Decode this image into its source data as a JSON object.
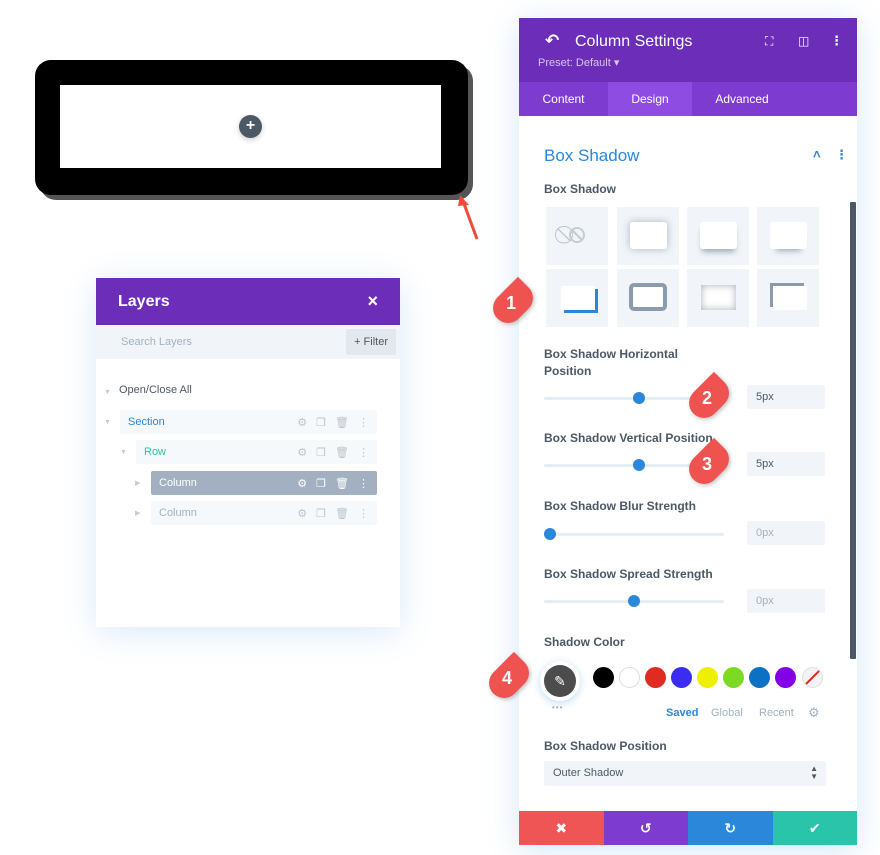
{
  "canvas": {
    "add_icon": "+"
  },
  "layers": {
    "title": "Layers",
    "close_icon": "×",
    "search_placeholder": "Search Layers",
    "filter_label": "+ Filter",
    "open_close_all": "Open/Close All",
    "items": [
      {
        "label": "Section",
        "color": "#2b87da"
      },
      {
        "label": "Row",
        "color": "#29c4a9"
      },
      {
        "label": "Column",
        "active": true
      },
      {
        "label": "Column"
      }
    ]
  },
  "panel": {
    "title": "Column Settings",
    "preset": "Preset: Default ▾",
    "tabs": [
      "Content",
      "Design",
      "Advanced"
    ],
    "active_tab": "Design",
    "section_title": "Box Shadow",
    "box_shadow_label": "Box Shadow",
    "selected_preset_index": 4,
    "fields": [
      {
        "label": "Box Shadow Horizontal Position",
        "value": "5px",
        "slider_fraction": 0.51
      },
      {
        "label": "Box Shadow Vertical Position",
        "value": "5px",
        "slider_fraction": 0.51
      },
      {
        "label": "Box Shadow Blur Strength",
        "value": "0px",
        "slider_fraction": 0.0
      },
      {
        "label": "Box Shadow Spread Strength",
        "value": "0px",
        "slider_fraction": 0.5
      }
    ],
    "shadow_color_label": "Shadow Color",
    "swatches": [
      "#000000",
      "#ffffff",
      "#e02b20",
      "#3a2cf2",
      "#edf000",
      "#7cda24",
      "#0c71c3",
      "#8300e9"
    ],
    "color_tabs": [
      "Saved",
      "Global",
      "Recent"
    ],
    "active_color_tab": "Saved",
    "more_dots": "•••",
    "position_label": "Box Shadow Position",
    "position_value": "Outer Shadow"
  },
  "footer": {
    "cancel_icon": "✖",
    "undo_icon": "↺",
    "redo_icon": "↻",
    "save_icon": "✔",
    "colors": {
      "cancel": "#ef5555",
      "undo": "#7e3bd0",
      "redo": "#2b87da",
      "save": "#29c4a9"
    }
  },
  "annotations": [
    "1",
    "2",
    "3",
    "4"
  ]
}
